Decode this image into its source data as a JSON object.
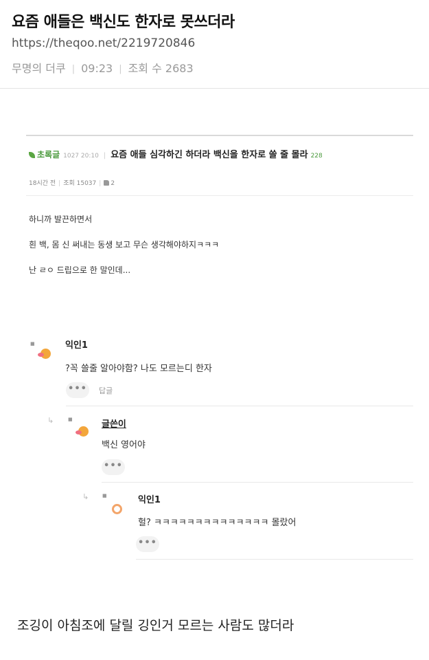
{
  "post": {
    "title": "요즘 애들은 백신도 한자로 못쓰더라",
    "url": "https://theqoo.net/2219720846",
    "author": "무명의 더쿠",
    "time": "09:23",
    "views": "조회 수 2683"
  },
  "screenshot": {
    "category": "초록글",
    "date": "1027 20:10",
    "title": "요즘 애들 심각하긴 하더라 백신을 한자로 쓸 줄 몰라",
    "comment_count": "228",
    "posted_ago": "18시간 전",
    "views": "조회 15037",
    "likes": "2",
    "body_lines": [
      "하니까 발끈하면서",
      "흰 백, 몸 신 써내는 동생 보고 무슨 생각해야하지ㅋㅋㅋ",
      "난 ㄹㅇ 드립으로 한 말인데..."
    ],
    "comments": [
      {
        "nick": "익인1",
        "text": "?꼭 쓸줄 알아야함? 나도 모르는디 한자",
        "more": "•••",
        "reply": "답글"
      },
      {
        "nick": "글쓴이",
        "text": "백신 영어야",
        "more": "•••"
      },
      {
        "nick": "익인1",
        "text": "헐? ㅋㅋㅋㅋㅋㅋㅋㅋㅋㅋㅋㅋㅋㅋ 몰랐어",
        "more": "•••"
      }
    ]
  },
  "caption": "조깅이 아침조에 달릴 깅인거 모르는 사람도 많더라"
}
